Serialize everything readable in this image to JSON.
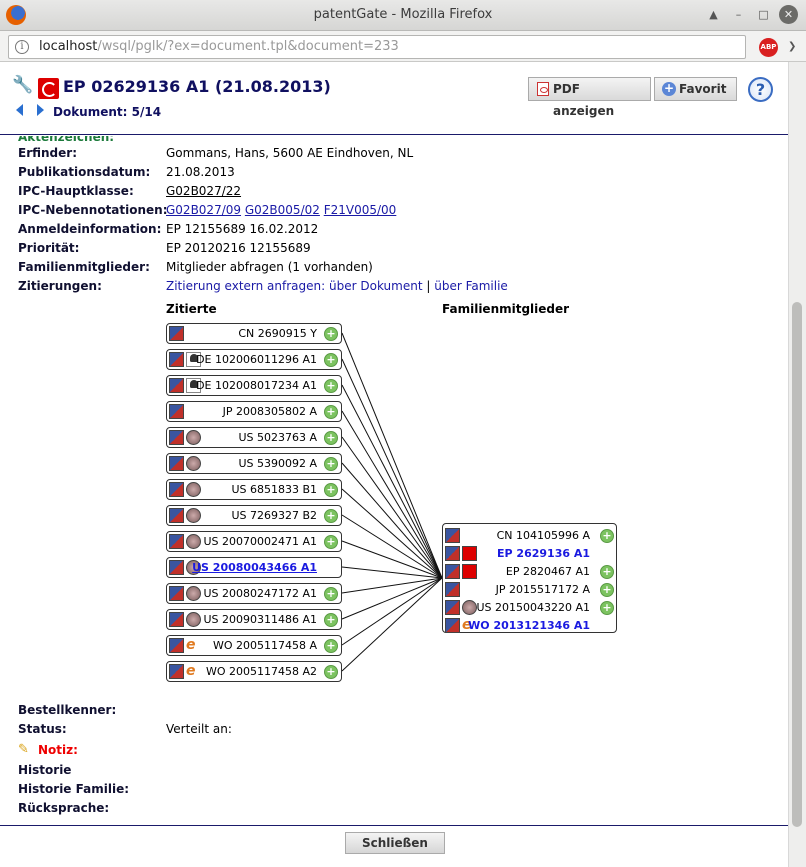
{
  "window": {
    "title": "patentGate - Mozilla Firefox"
  },
  "browser": {
    "url_host": "localhost",
    "url_path": "/wsql/pglk/?ex=document.tpl&document=233",
    "adblock_label": "ABP"
  },
  "header": {
    "title": "EP 02629136 A1 (21.08.2013)",
    "doc_counter": "Dokument: 5/14",
    "pdf_button": "PDF anzeigen",
    "fav_button": "Favorit",
    "help": "?"
  },
  "fields": {
    "partial_label": "Aktenzeichen:",
    "erfinder": {
      "label": "Erfinder:",
      "value": "Gommans, Hans, 5600 AE Eindhoven, NL"
    },
    "publikationsdatum": {
      "label": "Publikationsdatum:",
      "value": "21.08.2013"
    },
    "ipc_haupt": {
      "label": "IPC-Hauptklasse:",
      "value": "G02B027/22"
    },
    "ipc_neben": {
      "label": "IPC-Nebennotationen:",
      "values": [
        "G02B027/09",
        "G02B005/02",
        "F21V005/00"
      ]
    },
    "anmelde": {
      "label": "Anmeldeinformation:",
      "value": "EP 12155689 16.02.2012"
    },
    "prioritaet": {
      "label": "Priorität:",
      "value": "EP 20120216 12155689"
    },
    "familie": {
      "label": "Familienmitglieder:",
      "value": "Mitglieder abfragen (1 vorhanden)"
    },
    "zitierungen": {
      "label": "Zitierungen:",
      "prefix": "Zitierung extern anfragen:",
      "link1": "über Dokument",
      "sep": "|",
      "link2": "über Familie"
    }
  },
  "graph": {
    "cited_heading": "Zitierte",
    "family_heading": "Familienmitglieder",
    "cited": [
      {
        "text": "CN 2690915 Y",
        "flag2": "",
        "plus": true,
        "highlight": false
      },
      {
        "text": "DE 102006011296 A1",
        "flag2": "de",
        "plus": true,
        "highlight": false
      },
      {
        "text": "DE 102008017234 A1",
        "flag2": "de",
        "plus": true,
        "highlight": false
      },
      {
        "text": "JP 2008305802 A",
        "flag2": "",
        "plus": true,
        "highlight": false
      },
      {
        "text": "US 5023763 A",
        "flag2": "us",
        "plus": true,
        "highlight": false
      },
      {
        "text": "US 5390092 A",
        "flag2": "us",
        "plus": true,
        "highlight": false
      },
      {
        "text": "US 6851833 B1",
        "flag2": "us",
        "plus": true,
        "highlight": false
      },
      {
        "text": "US 7269327 B2",
        "flag2": "us",
        "plus": true,
        "highlight": false
      },
      {
        "text": "US 20070002471 A1",
        "flag2": "us",
        "plus": true,
        "highlight": false
      },
      {
        "text": "US 20080043466 A1",
        "flag2": "us",
        "plus": false,
        "highlight": true
      },
      {
        "text": "US 20080247172 A1",
        "flag2": "us",
        "plus": true,
        "highlight": false
      },
      {
        "text": "US 20090311486 A1",
        "flag2": "us",
        "plus": true,
        "highlight": false
      },
      {
        "text": "WO 2005117458 A",
        "flag2": "wo",
        "plus": true,
        "highlight": false
      },
      {
        "text": "WO 2005117458 A2",
        "flag2": "wo",
        "plus": true,
        "highlight": false
      }
    ],
    "family": [
      {
        "text": "CN 104105996 A",
        "flag2": "",
        "plus": true,
        "bold": false
      },
      {
        "text": "EP 2629136 A1",
        "flag2": "ep",
        "plus": false,
        "bold": true
      },
      {
        "text": "EP 2820467 A1",
        "flag2": "ep",
        "plus": true,
        "bold": false
      },
      {
        "text": "JP 2015517172 A",
        "flag2": "",
        "plus": true,
        "bold": false
      },
      {
        "text": "US 20150043220 A1",
        "flag2": "us",
        "plus": true,
        "bold": false
      },
      {
        "text": "WO 2013121346 A1",
        "flag2": "wo",
        "plus": false,
        "bold": true
      }
    ]
  },
  "lower_fields": {
    "bestell": {
      "label": "Bestellkenner:"
    },
    "status": {
      "label": "Status:",
      "value": "Verteilt an:"
    },
    "notiz": {
      "label": "Notiz:"
    },
    "historie": {
      "label": "Historie"
    },
    "historie_familie": {
      "label": "Historie Familie:"
    },
    "ruecksprache": {
      "label": "Rücksprache:"
    }
  },
  "footer": {
    "close_button": "Schließen"
  }
}
